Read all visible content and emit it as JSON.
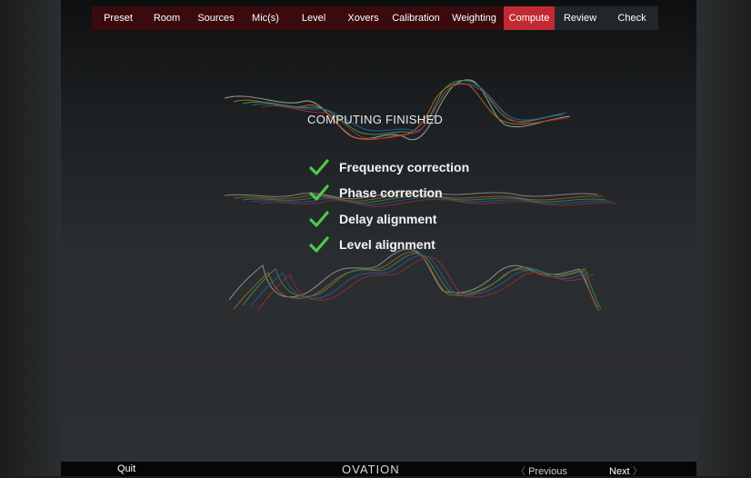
{
  "nav": {
    "tabs": [
      {
        "label": "Preset"
      },
      {
        "label": "Room"
      },
      {
        "label": "Sources"
      },
      {
        "label": "Mic(s)"
      },
      {
        "label": "Level"
      },
      {
        "label": "Xovers"
      },
      {
        "label": "Calibration"
      },
      {
        "label": "Weighting"
      },
      {
        "label": "Compute",
        "active": true
      },
      {
        "label": "Review"
      },
      {
        "label": "Check"
      }
    ]
  },
  "status": {
    "title": "COMPUTING FINISHED",
    "items": [
      {
        "label": "Frequency correction",
        "icon": "checkmark-icon",
        "done": true
      },
      {
        "label": "Phase correction",
        "icon": "checkmark-icon",
        "done": true
      },
      {
        "label": "Delay alignment",
        "icon": "checkmark-icon",
        "done": true
      },
      {
        "label": "Level alignment",
        "icon": "checkmark-icon",
        "done": true
      }
    ]
  },
  "footer": {
    "quit": "Quit",
    "logo": "OVATION",
    "previous": "Previous",
    "next": "Next",
    "prev_chevron": "〈",
    "next_chevron": "〉"
  },
  "colors": {
    "accent": "#c22a33",
    "nav_dark_red": "#3a0a0d",
    "check_green": "#4cc94f",
    "wave_colors": [
      "#c8c9ca",
      "#e07a1f",
      "#3fbf5f",
      "#2f6fc8",
      "#c93030"
    ]
  }
}
